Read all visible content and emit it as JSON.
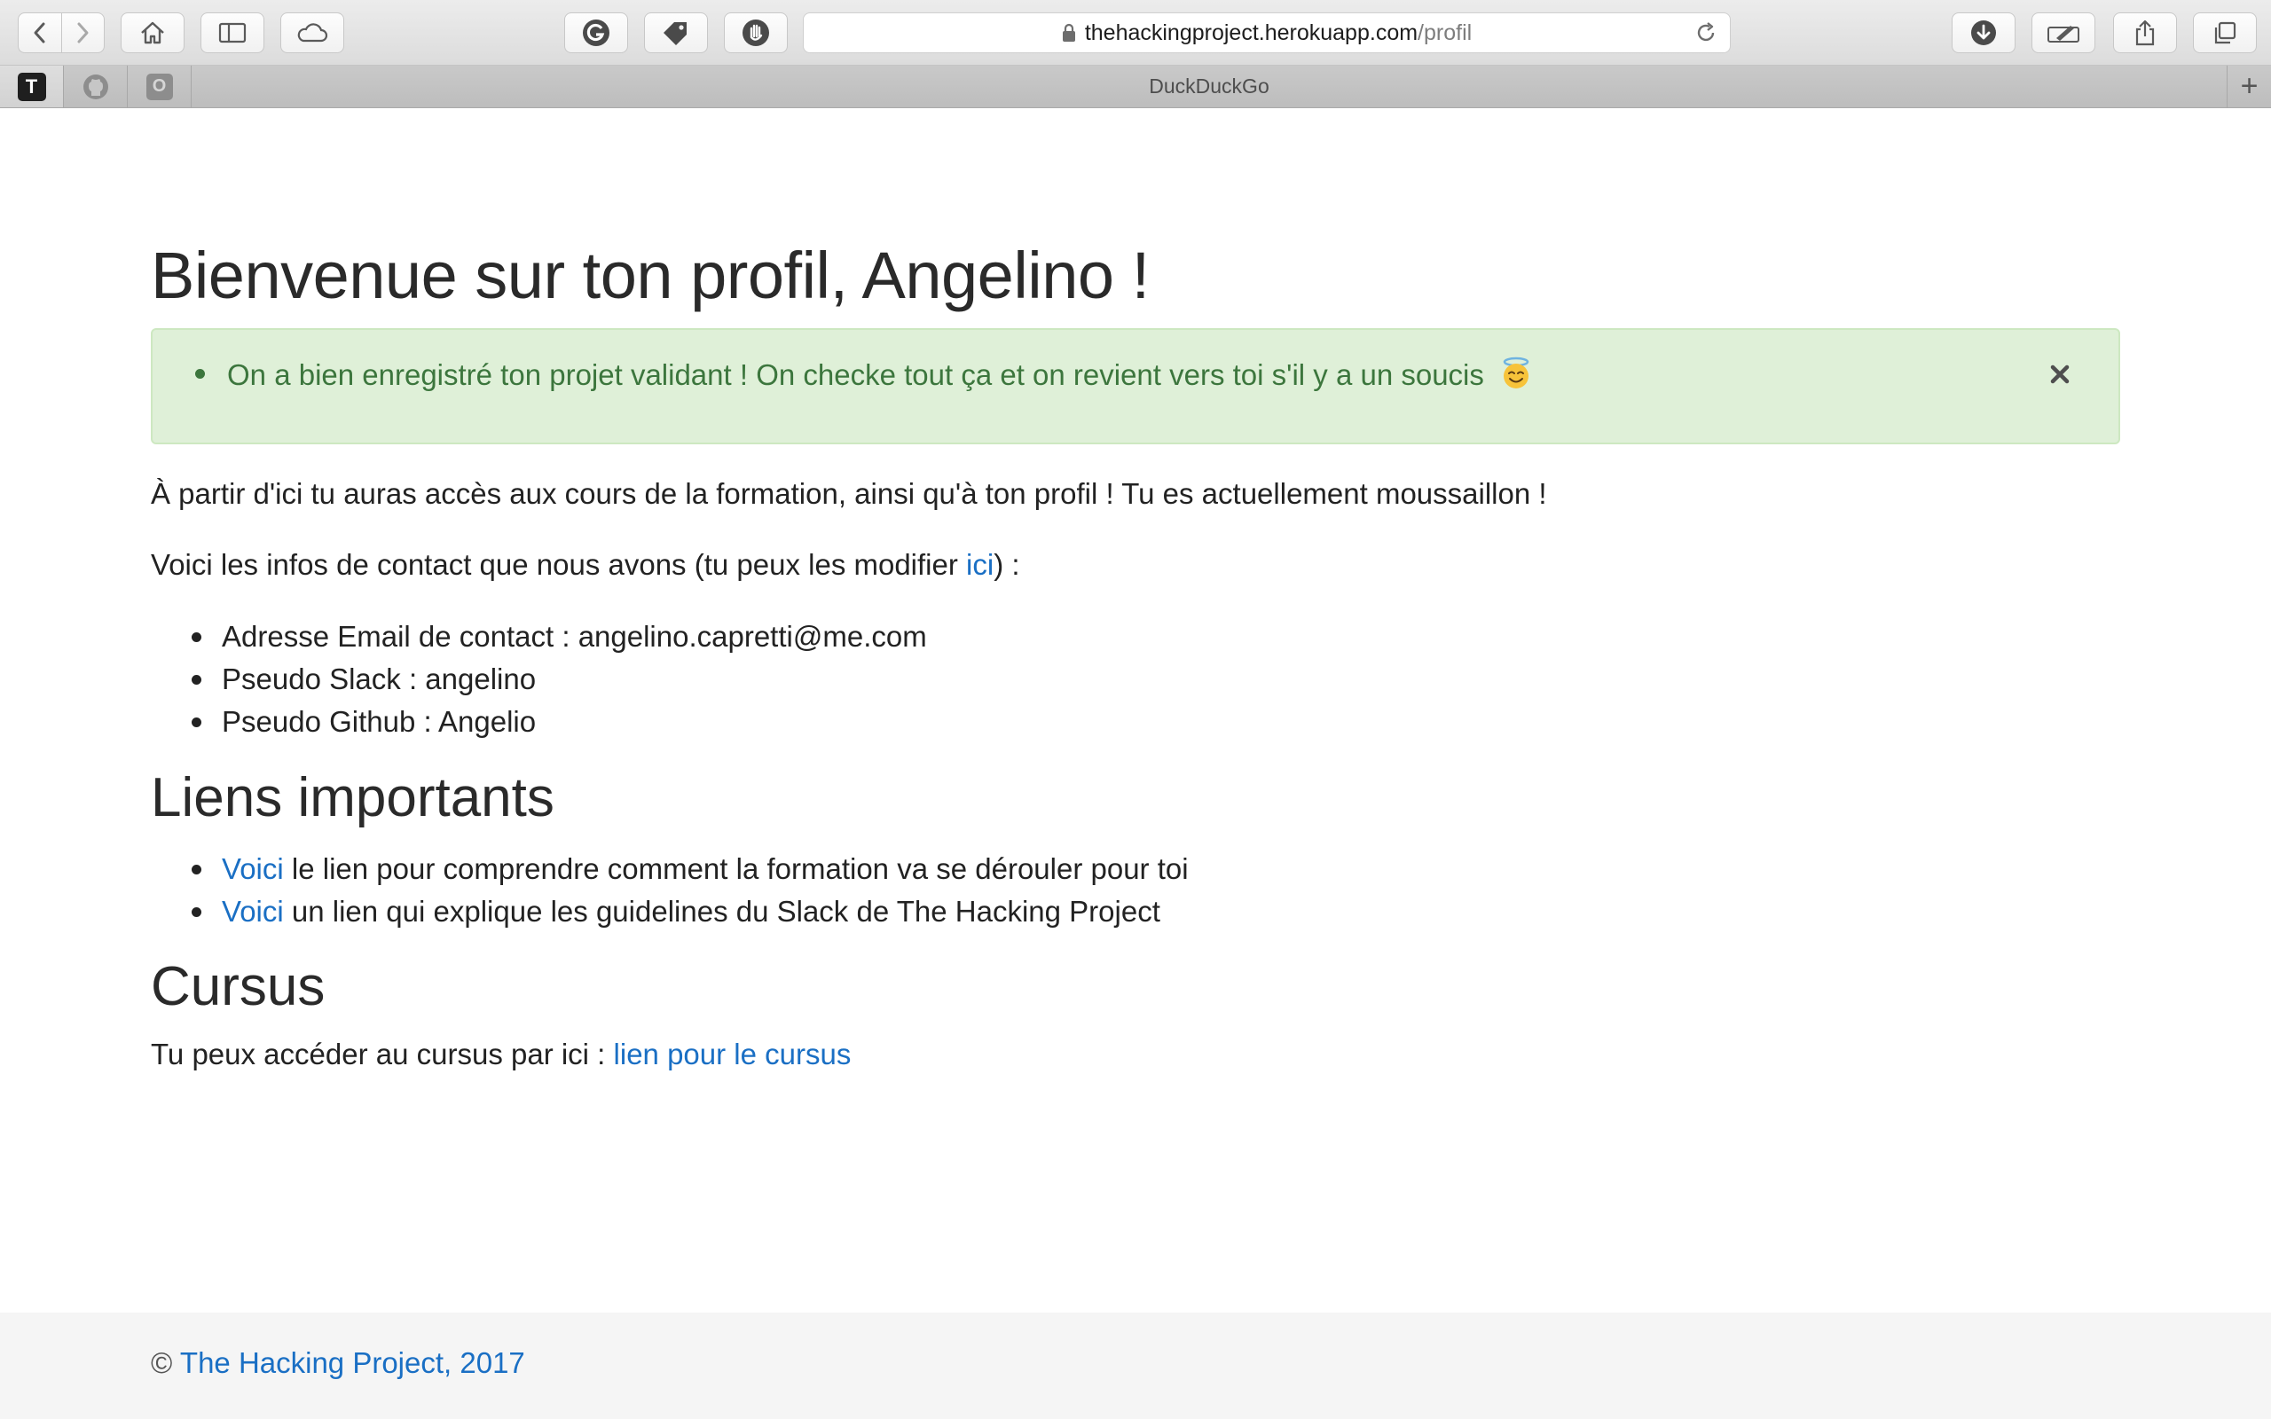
{
  "browser": {
    "url_host": "thehackingproject.herokuapp.com",
    "url_path": "/profil",
    "tab_title": "DuckDuckGo",
    "pinned_tabs": [
      {
        "label": "T",
        "icon": "t-favicon"
      },
      {
        "label": "",
        "icon": "github-icon"
      },
      {
        "label": "O",
        "icon": "o-favicon"
      }
    ],
    "new_tab_label": "+"
  },
  "page": {
    "title": "Bienvenue sur ton profil, Angelino !",
    "alert": {
      "message": "On a bien enregistré ton projet validant ! On checke tout ça et on revient vers toi s'il y a un soucis",
      "emoji": "smiling-face-with-halo",
      "close_label": "×"
    },
    "intro": "À partir d'ici tu auras accès aux cours de la formation, ainsi qu'à ton profil ! Tu es actuellement moussaillon !",
    "contact_intro_before": "Voici les infos de contact que nous avons (tu peux les modifier ",
    "contact_intro_link": "ici",
    "contact_intro_after": ") :",
    "contact_items": [
      "Adresse Email de contact : angelino.capretti@me.com",
      "Pseudo Slack : angelino",
      "Pseudo Github : Angelio"
    ],
    "links_heading": "Liens importants",
    "links": [
      {
        "link": "Voici",
        "text": " le lien pour comprendre comment la formation va se dérouler pour toi"
      },
      {
        "link": "Voici",
        "text": " un lien qui explique les guidelines du Slack de The Hacking Project"
      }
    ],
    "cursus_heading": "Cursus",
    "cursus_before": "Tu peux accéder au cursus par ici : ",
    "cursus_link": "lien pour le cursus"
  },
  "footer": {
    "copyright_symbol": "©",
    "link": "The Hacking Project, 2017"
  },
  "colors": {
    "link": "#1a6fc4",
    "alert_bg": "#dff0d8",
    "alert_text": "#3c763d"
  }
}
